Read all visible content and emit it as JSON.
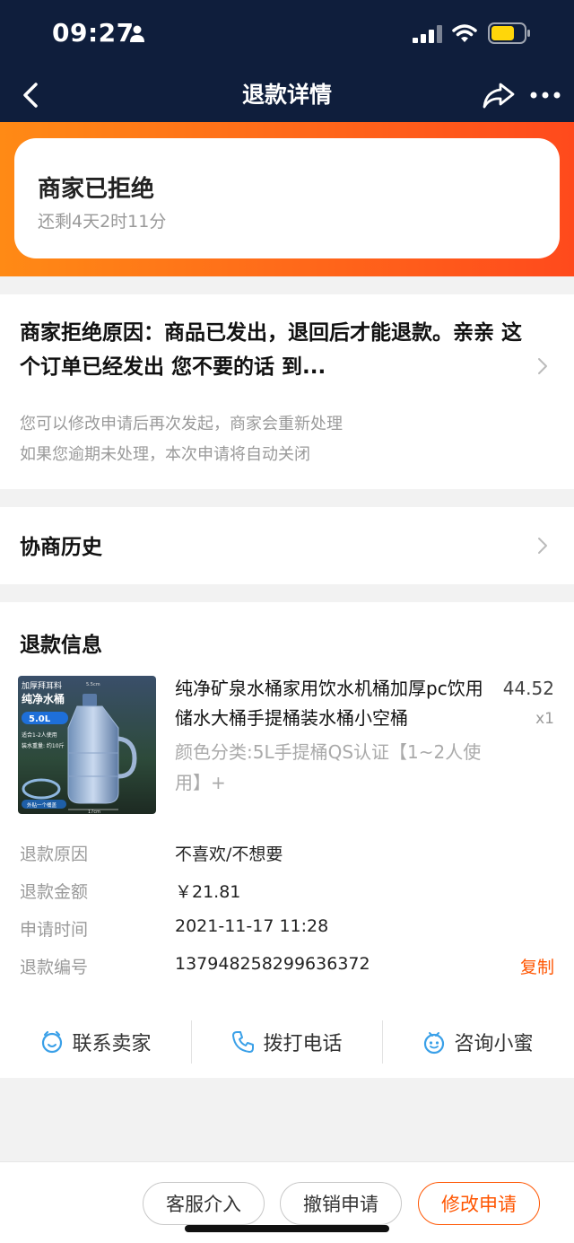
{
  "status_bar": {
    "time": "09:27"
  },
  "nav": {
    "title": "退款详情"
  },
  "status_card": {
    "title": "商家已拒绝",
    "countdown": "还剩4天2时11分"
  },
  "reason": {
    "title": "商家拒绝原因：商品已发出，退回后才能退款。亲亲 这个订单已经发出 您不要的话 到...",
    "hint_line1": "您可以修改申请后再次发起，商家会重新处理",
    "hint_line2": "如果您逾期未处理，本次申请将自动关闭"
  },
  "history": {
    "label": "协商历史"
  },
  "refund_info": {
    "title": "退款信息",
    "product": {
      "name": "纯净矿泉水桶家用饮水机桶加厚pc饮用储水大桶手提桶装水桶小空桶",
      "price": "44.52",
      "qty": "x1",
      "spec": "颜色分类:5L手提桶QS认证【1~2人使用】+",
      "thumb_text": {
        "line1": "加厚拜耳料",
        "line2": "纯净水桶",
        "capacity": "5.0L",
        "note1": "适合1-2人使用",
        "note2": "装水重量: 约10斤",
        "tag": "外贴一个桶盖",
        "dim_top": "5.5cm",
        "dim_bottom": "17cm"
      }
    },
    "rows": [
      {
        "label": "退款原因",
        "value": "不喜欢/不想要"
      },
      {
        "label": "退款金额",
        "value": "￥21.81"
      },
      {
        "label": "申请时间",
        "value": "2021-11-17 11:28"
      },
      {
        "label": "退款编号",
        "value": "137948258299636372"
      }
    ],
    "copy_label": "复制"
  },
  "actions": {
    "contact_seller": "联系卖家",
    "call": "拨打电话",
    "ask_assistant": "咨询小蜜"
  },
  "bottom": {
    "service": "客服介入",
    "cancel": "撤销申请",
    "modify": "修改申请"
  },
  "colors": {
    "accent": "#ff5500",
    "nav_bg": "#0f1e3c",
    "icon_blue": "#3aa0e8"
  }
}
